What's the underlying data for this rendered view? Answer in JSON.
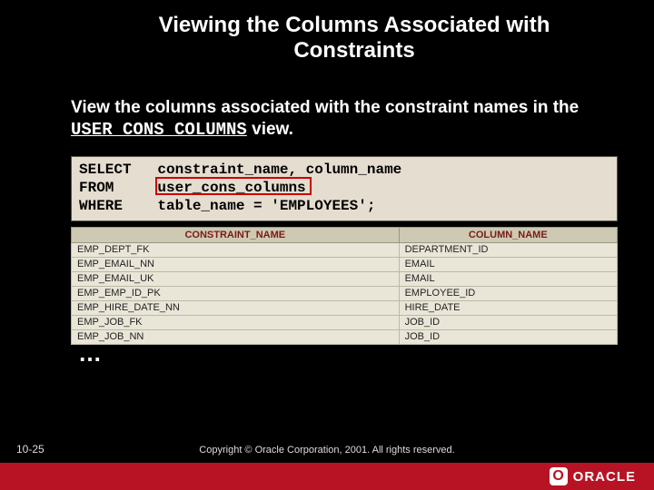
{
  "title_line1": "Viewing the Columns Associated with",
  "title_line2": "Constraints",
  "subtitle_prefix": "View the columns associated with the constraint names in the ",
  "subtitle_mono": "USER_CONS_COLUMNS",
  "subtitle_suffix": " view.",
  "sql": {
    "kw_select": "SELECT",
    "cols": "constraint_name, column_name",
    "kw_from": "FROM",
    "tbl": "user_cons_columns",
    "kw_where": "WHERE",
    "cond": "table_name = 'EMPLOYEES';"
  },
  "table": {
    "headers": [
      "CONSTRAINT_NAME",
      "COLUMN_NAME"
    ],
    "rows": [
      [
        "EMP_DEPT_FK",
        "DEPARTMENT_ID"
      ],
      [
        "EMP_EMAIL_NN",
        "EMAIL"
      ],
      [
        "EMP_EMAIL_UK",
        "EMAIL"
      ],
      [
        "EMP_EMP_ID_PK",
        "EMPLOYEE_ID"
      ],
      [
        "EMP_HIRE_DATE_NN",
        "HIRE_DATE"
      ],
      [
        "EMP_JOB_FK",
        "JOB_ID"
      ],
      [
        "EMP_JOB_NN",
        "JOB_ID"
      ]
    ]
  },
  "ellipsis": "…",
  "slide_number": "10-25",
  "copyright": "Copyright © Oracle Corporation, 2001. All rights reserved.",
  "logo_text": "ORACLE",
  "logo_o": "O"
}
